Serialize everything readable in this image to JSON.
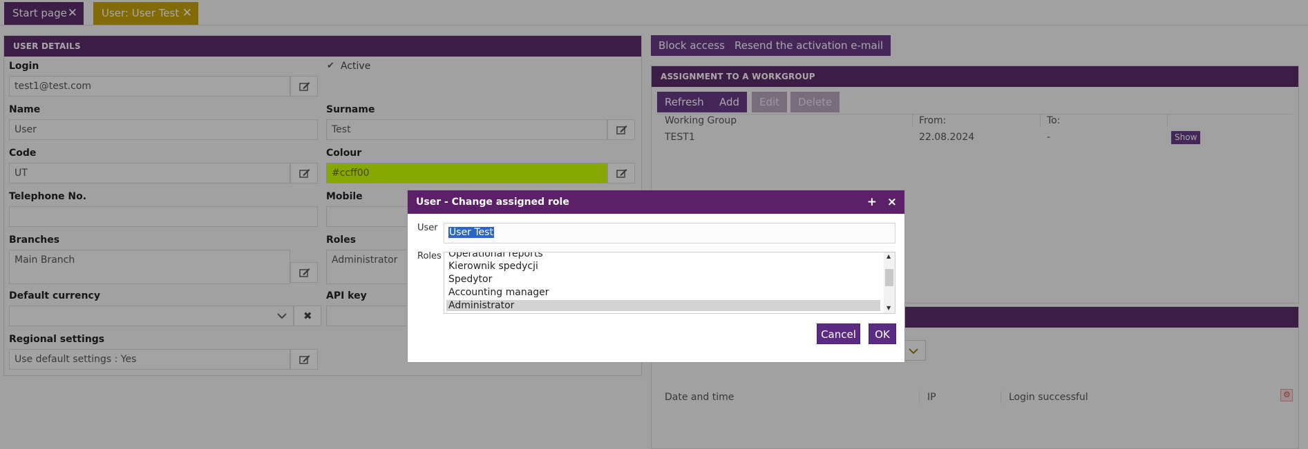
{
  "tabs": [
    {
      "label": "Start page"
    },
    {
      "label": "User: User Test"
    }
  ],
  "user_details": {
    "header": "USER DETAILS",
    "login_label": "Login",
    "login_value": "test1@test.com",
    "active_label": "Active",
    "name_label": "Name",
    "name_value": "User",
    "surname_label": "Surname",
    "surname_value": "Test",
    "code_label": "Code",
    "code_value": "UT",
    "colour_label": "Colour",
    "colour_value": "#ccff00",
    "telephone_label": "Telephone No.",
    "mobile_label": "Mobile",
    "branches_label": "Branches",
    "branches_value": "Main Branch",
    "roles_label": "Roles",
    "roles_value": "Administrator",
    "currency_label": "Default currency",
    "apikey_label": "API key",
    "regional_label": "Regional settings",
    "regional_value": "Use default settings : Yes"
  },
  "actions": {
    "block_access": "Block access",
    "resend": "Resend the activation e-mail"
  },
  "workgroup": {
    "header": "ASSIGNMENT TO A WORKGROUP",
    "buttons": {
      "refresh": "Refresh",
      "add": "Add",
      "edit": "Edit",
      "delete": "Delete"
    },
    "columns": [
      "Working Group",
      "From:",
      "To:"
    ],
    "rows": [
      {
        "group": "TEST1",
        "from": "22.08.2024",
        "to": "-",
        "action": "Show"
      }
    ]
  },
  "login_history": {
    "columns": [
      "Date and time",
      "IP",
      "Login successful"
    ]
  },
  "dialog": {
    "title": "User - Change assigned role",
    "plus": "+",
    "close": "×",
    "user_label": "User",
    "user_value": "User Test",
    "roles_label": "Roles",
    "roles": [
      "Operational reports",
      "Kierownik spedycji",
      "Spedytor",
      "Accounting manager",
      "Administrator"
    ],
    "selected_role": "Administrator",
    "cancel": "Cancel",
    "ok": "OK"
  },
  "colors": {
    "header_purple": "#5a2c6b",
    "button_purple": "#6a3a86",
    "tab_gold": "#c6a20b",
    "colour_field": "#ccff00"
  }
}
